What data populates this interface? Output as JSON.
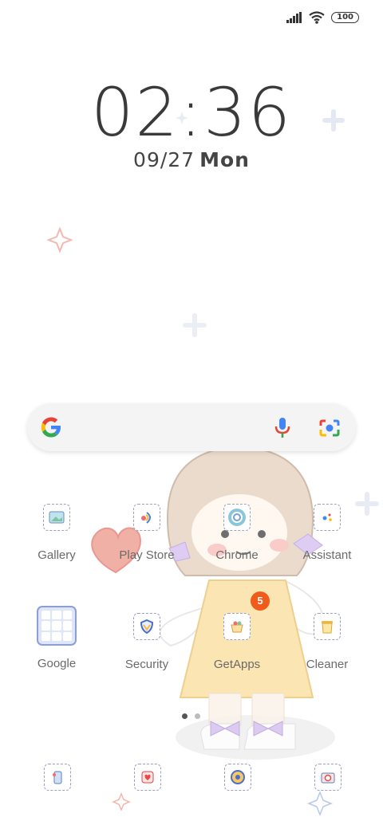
{
  "status_bar": {
    "battery": "100"
  },
  "lockscreen": {
    "time": "02:36",
    "date": "09/27",
    "weekday": "Mon"
  },
  "apps_row1": [
    {
      "label": "Gallery"
    },
    {
      "label": "Play Store"
    },
    {
      "label": "Chrome"
    },
    {
      "label": "Assistant"
    }
  ],
  "apps_row2": [
    {
      "label": "Google"
    },
    {
      "label": "Security"
    },
    {
      "label": "GetApps"
    },
    {
      "label": "Cleaner"
    }
  ],
  "badges": {
    "getapps": "5"
  },
  "colors": {
    "accent_badge": "#f05a1a",
    "tile_border": "#9aa0c0"
  }
}
